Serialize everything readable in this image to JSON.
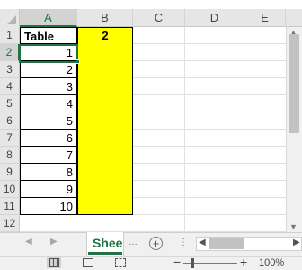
{
  "columns": [
    "A",
    "B",
    "C",
    "D",
    "E"
  ],
  "rows": [
    "1",
    "2",
    "3",
    "4",
    "5",
    "6",
    "7",
    "8",
    "9",
    "10",
    "11",
    "12"
  ],
  "cells": {
    "A1": "Table",
    "B1": "2",
    "A_values": [
      "1",
      "2",
      "3",
      "4",
      "5",
      "6",
      "7",
      "8",
      "9",
      "10"
    ]
  },
  "fill_color": "#ffff00",
  "accent_color": "#217346",
  "sheet_tab": {
    "label": "Shee"
  },
  "nav_icons": [
    "scroll-left-icon",
    "scroll-right-icon"
  ],
  "view_icons": [
    "normal-view-icon",
    "page-layout-icon",
    "page-break-icon"
  ],
  "zoom": {
    "label": "100%",
    "minus": "−",
    "plus": "+"
  }
}
